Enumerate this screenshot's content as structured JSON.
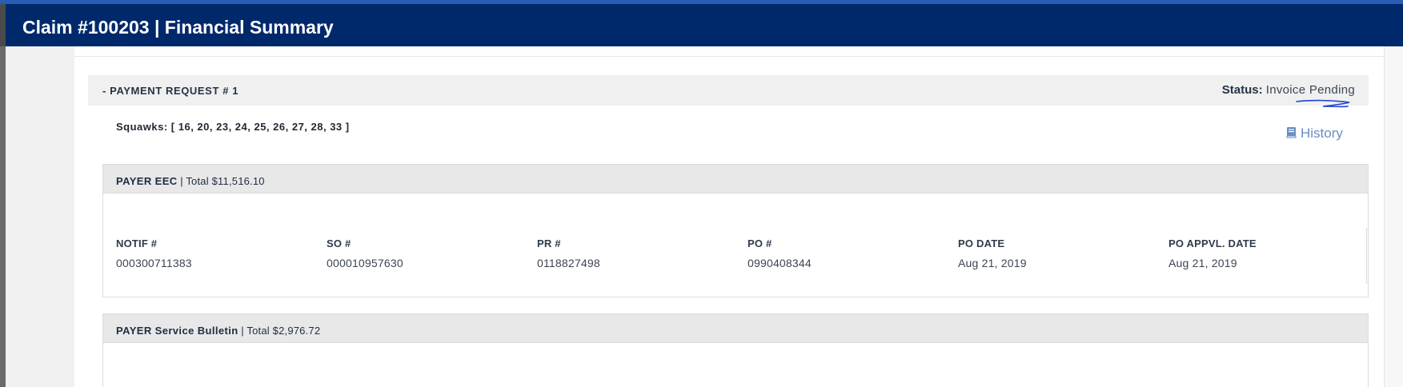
{
  "header": {
    "title": "Claim #100203 | Financial Summary"
  },
  "payment_request": {
    "title": "- PAYMENT REQUEST # 1",
    "status_label": "Status:",
    "status_value": "Invoice Pending",
    "squawks": "Squawks: [ 16, 20, 23, 24, 25, 26, 27, 28, 33 ]",
    "history_label": "History",
    "history_icon": "book-icon"
  },
  "payers": [
    {
      "name": "PAYER EEC",
      "total": "| Total $11,516.10",
      "fields": [
        {
          "label": "NOTIF #",
          "value": "000300711383"
        },
        {
          "label": "SO #",
          "value": "000010957630"
        },
        {
          "label": "PR #",
          "value": "0118827498"
        },
        {
          "label": "PO #",
          "value": "0990408344"
        },
        {
          "label": "PO DATE",
          "value": "Aug 21, 2019"
        },
        {
          "label": "PO APPVL. DATE",
          "value": "Aug 21, 2019"
        }
      ]
    },
    {
      "name": "PAYER Service Bulletin",
      "total": "| Total $2,976.72"
    }
  ],
  "colors": {
    "header_bg": "#00296b",
    "link": "#6a8ec2",
    "annotation": "#1f3fd6"
  }
}
